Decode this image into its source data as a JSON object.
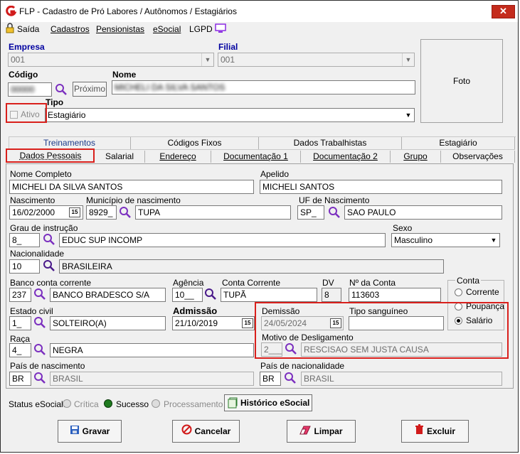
{
  "window": {
    "title": "FLP - Cadastro de Pró Labores / Autônomos / Estagiários",
    "close_symbol": "✕"
  },
  "menu": {
    "saida": "Saída",
    "cadastros": "Cadastros",
    "pensionistas": "Pensionistas",
    "esocial": "eSocial",
    "lgpd": "LGPD"
  },
  "header": {
    "empresa_label": "Empresa",
    "empresa_value": "001",
    "filial_label": "Filial",
    "filial_value": "001",
    "codigo_label": "Código",
    "codigo_value": "00000",
    "proximo_label": "Próximo",
    "nome_label": "Nome",
    "nome_value": "MICHELI DA SILVA SANTOS",
    "tipo_label": "Tipo",
    "tipo_value": "Estagiário",
    "ativo_label": "Ativo",
    "foto_label": "Foto"
  },
  "tabs_row1": [
    "Treinamentos",
    "Códigos Fixos",
    "Dados Trabalhistas",
    "Estagiário"
  ],
  "tabs_row2": [
    "Dados Pessoais",
    "Salarial",
    "Endereço",
    "Documentação 1",
    "Documentação 2",
    "Grupo",
    "Observações"
  ],
  "form": {
    "nome_completo_label": "Nome Completo",
    "nome_completo": "MICHELI DA SILVA SANTOS",
    "apelido_label": "Apelido",
    "apelido": "MICHELI SANTOS",
    "nascimento_label": "Nascimento",
    "nascimento": "16/02/2000",
    "municipio_label": "Município de nascimento",
    "municipio_cod": "8929_",
    "municipio": "TUPA",
    "uf_label": "UF de Nascimento",
    "uf_cod": "SP_",
    "uf": "SAO PAULO",
    "grau_label": "Grau de instrução",
    "grau_cod": "8_",
    "grau": "EDUC SUP INCOMP",
    "sexo_label": "Sexo",
    "sexo": "Masculino",
    "nacionalidade_label": "Nacionalidade",
    "nacionalidade_cod": "10",
    "nacionalidade": "BRASILEIRA",
    "banco_label": "Banco conta corrente",
    "banco_cod": "237",
    "banco": "BANCO BRADESCO S/A",
    "agencia_label": "Agência",
    "agencia": "10__",
    "conta_label": "Conta Corrente",
    "conta": "TUPÃ",
    "dv_label": "DV",
    "dv": "8",
    "nconta_label": "Nº da Conta",
    "nconta": "113603",
    "conta_group_label": "Conta",
    "conta_corrente_opt": "Corrente",
    "conta_poupanca_opt": "Poupança",
    "conta_salario_opt": "Salário",
    "estado_civil_label": "Estado civil",
    "estado_civil_cod": "1_",
    "estado_civil": "SOLTEIRO(A)",
    "admissao_label": "Admissão",
    "admissao": "21/10/2019",
    "demissao_label": "Demissão",
    "demissao": "24/05/2024",
    "sangue_label": "Tipo sanguíneo",
    "sangue": "",
    "raca_label": "Raça",
    "raca_cod": "4_",
    "raca": "NEGRA",
    "motivo_label": "Motivo de Desligamento",
    "motivo_cod": "2___",
    "motivo": "RESCISAO SEM JUSTA CAUSA",
    "pais_nasc_label": "País de nascimento",
    "pais_nasc_cod": "BR",
    "pais_nasc": "BRASIL",
    "pais_nac_label": "País de nacionalidade",
    "pais_nac_cod": "BR",
    "pais_nac": "BRASIL",
    "cal_icon_text": "15"
  },
  "status": {
    "label": "Status eSocial:",
    "critica": "Crítica",
    "sucesso": "Sucesso",
    "processamento": "Processamento",
    "historico": "Histórico eSocial"
  },
  "buttons": {
    "gravar": "Gravar",
    "cancelar": "Cancelar",
    "limpar": "Limpar",
    "excluir": "Excluir"
  },
  "colors": {
    "highlight": "#d9201c",
    "tab_blue": "#1a3a8a",
    "close_red": "#c42b1c",
    "search_purple": "#7b2fbf"
  }
}
